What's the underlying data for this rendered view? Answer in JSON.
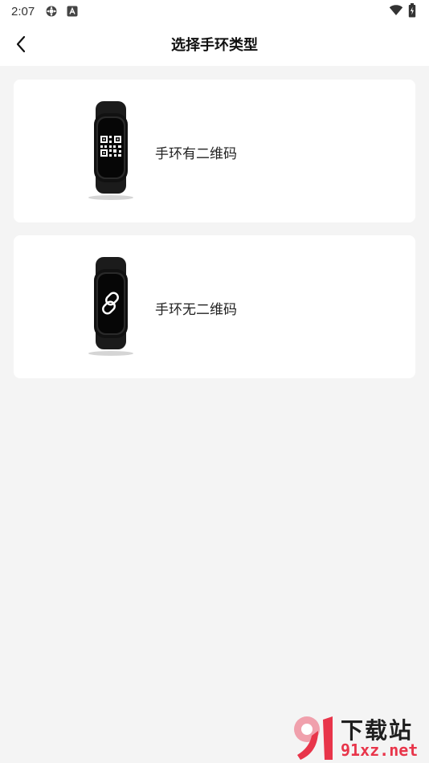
{
  "status_bar": {
    "time": "2:07"
  },
  "header": {
    "title": "选择手环类型"
  },
  "options": [
    {
      "label": "手环有二维码",
      "icon": "qr-code-icon"
    },
    {
      "label": "手环无二维码",
      "icon": "link-icon"
    }
  ],
  "watermark": {
    "logo_text": "9",
    "chinese": "下载站",
    "url": "91xz.net"
  },
  "colors": {
    "background": "#f4f4f4",
    "card": "#ffffff",
    "watermark_red": "#e8354a"
  }
}
